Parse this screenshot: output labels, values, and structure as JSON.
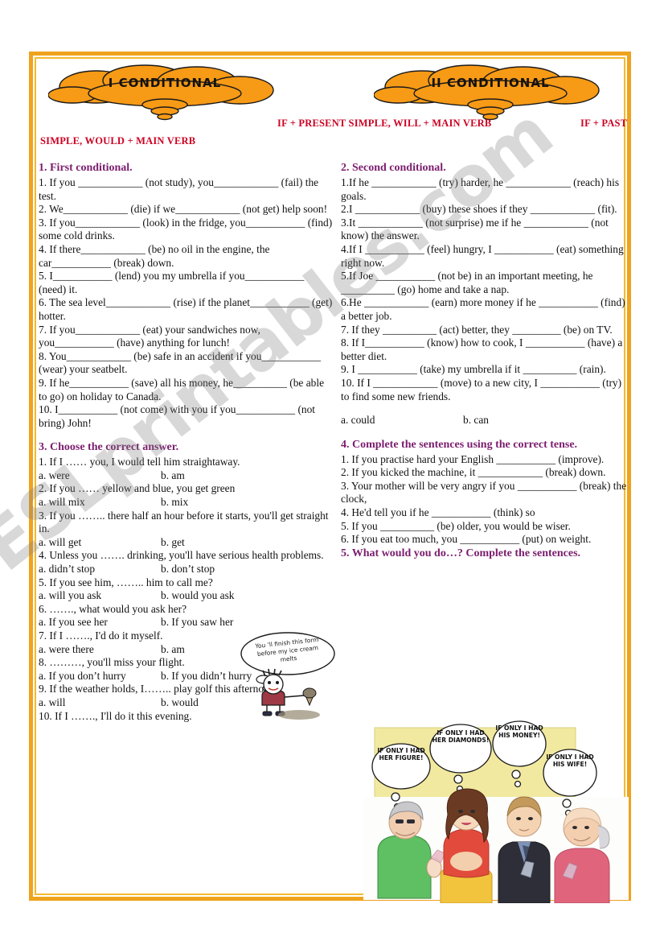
{
  "titles": {
    "left_cloud": "I CONDITIONAL",
    "right_cloud": "II CONDITIONAL"
  },
  "formulas": {
    "line1": "IF + PRESENT SIMPLE, WILL + MAIN VERB",
    "line1_right": "IF + PAST",
    "line2": "SIMPLE, WOULD + MAIN VERB"
  },
  "exercise1": {
    "heading": "1. First conditional.",
    "items": [
      "1. If you ____________ (not study), you____________ (fail) the test.",
      "2. We____________ (die) if we____________ (not get) help soon!",
      "3. If you____________ (look) in the fridge, you___________ (find) some cold drinks.",
      "4. If there____________ (be) no oil in the engine, the car___________ (break) down.",
      "5. I___________ (lend) you my umbrella if you___________ (need) it.",
      "6. The sea level____________ (rise) if the planet___________ (get) hotter.",
      "7. If you____________ (eat) your sandwiches now, you___________ (have) anything for lunch!",
      "8. You____________ (be) safe in an accident if you___________ (wear) your seatbelt.",
      "9. If he___________ (save) all his money, he__________ (be able to go) on holiday to Canada.",
      "10. I___________ (not come) with you if you___________ (not bring) John!"
    ]
  },
  "exercise2": {
    "heading": "2. Second conditional.",
    "items": [
      "1.If he ____________ (try) harder, he ____________ (reach) his goals.",
      "2.I ____________ (buy) these shoes if they ____________ (fit).",
      "3.It ____________ (not surprise) me if he ____________ (not know) the answer.",
      "4.If I ___________ (feel) hungry, I ___________ (eat) something right now.",
      "5.If Joe ___________ (not be) in an important meeting, he __________ (go) home and take a nap.",
      "6.He ____________ (earn) more money if he ___________ (find) a better job.",
      "7. If they __________ (act) better, they _________ (be) on TV.",
      "8. If I___________ (know) how to cook, I ___________ (have) a better diet.",
      "9. I ___________ (take) my umbrella if it __________ (rain).",
      "10.    If I ____________ (move) to a new city, I ___________ (try) to find some new friends."
    ],
    "answer_options": {
      "a": "a.  could",
      "b": "b.  can"
    }
  },
  "exercise3": {
    "heading": "3. Choose the correct answer.",
    "questions": [
      {
        "q": "1. If I …… you, I would tell him straightaway.",
        "a": "a.  were",
        "b": "b.  am"
      },
      {
        "q": "2.  If you …… yellow and blue, you get green",
        "a": "a.  will mix",
        "b": "b.  mix"
      },
      {
        "q": "3. If you …….. there half an hour before it starts, you'll get straight in.",
        "a": "a.  will get",
        "b": "b.  get"
      },
      {
        "q": "4. Unless you ……. drinking, you'll have serious health problems.",
        "a": "a.  didn’t stop",
        "b": "b.  don’t stop"
      },
      {
        "q": "5. If you see him, …….. him to call me?",
        "a": "a.  will you ask",
        "b": "b.  would you ask"
      },
      {
        "q": "6. ……., what would you ask her?",
        "a": "a. If you see her",
        "b": "b. If you saw her"
      },
      {
        "q": "7.  If I ……., I'd do it myself.",
        "a": "a.  were there",
        "b": "b.  am"
      },
      {
        "q": "8. ………, you'll miss your flight.",
        "a": "a. If you don’t hurry",
        "b": "b. If you didn’t hurry"
      },
      {
        "q": "9. If the weather holds, I…….. play golf this afternoon.",
        "a": "a.  will",
        "b": "b.  would"
      },
      {
        "q": "10. If I ……., I'll do it this evening.",
        "a": "",
        "b": ""
      }
    ]
  },
  "exercise4": {
    "heading": "4. Complete the sentences using the correct tense.",
    "items": [
      "1.  If you practise hard your English ___________ (improve).",
      "2.  If you kicked the machine, it ____________ (break) down.",
      "3.  Your mother will be very angry if you ___________ (break) the clock,",
      "4.  He'd tell you if he ___________ (think) so",
      "5.  If you __________ (be) older, you would be wiser.",
      "6.  If you eat too much, you ___________ (put) on weight."
    ]
  },
  "exercise5": {
    "heading": "5. What would you do…? Complete the sentences."
  },
  "kid_cartoon": {
    "bubble": "You ’ll finish this form before my ice cream melts"
  },
  "party_cartoon": {
    "bubbles": [
      "IF ONLY I HAD HER FIGURE!",
      "IF ONLY I HAD HER DIAMONDS!",
      "IF ONLY I HAD HIS MONEY!",
      "IF ONLY I HAD HIS WIFE!"
    ]
  },
  "watermark": {
    "text": "ESLprintables.com"
  },
  "colors": {
    "frame": "#efa31d",
    "cloud": "#f79a16",
    "heading": "#7b1d6e",
    "formula": "#cc0022"
  }
}
